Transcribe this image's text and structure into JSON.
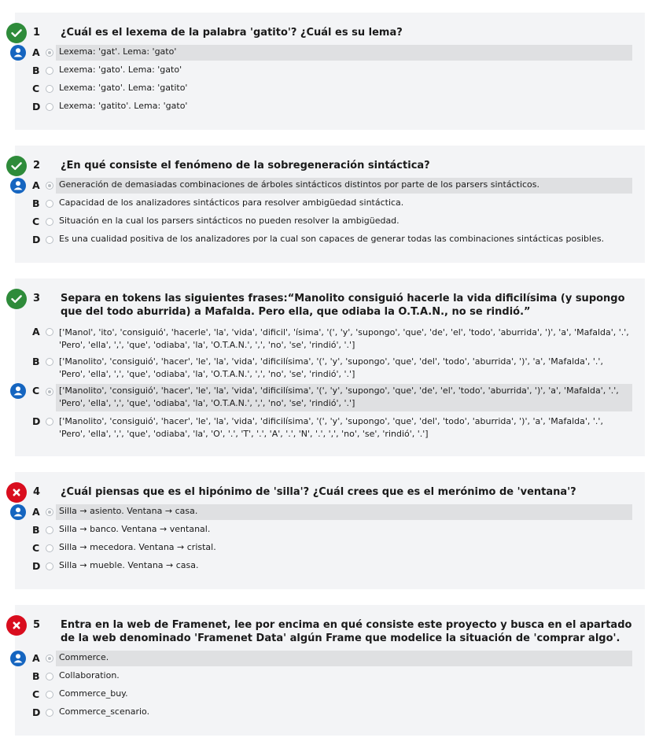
{
  "colors": {
    "correct": "#2e8b3a",
    "incorrect": "#d90d1e",
    "user": "#1565c0",
    "selected_bg": "#dfe0e2",
    "card_bg": "#f3f4f6"
  },
  "icons": {
    "correct": "check-circle-icon",
    "incorrect": "x-circle-icon",
    "user": "user-icon"
  },
  "questions": [
    {
      "number": "1",
      "status": "correct",
      "text": "¿Cuál es el lexema de la palabra 'gatito'? ¿Cuál es su lema?",
      "selected": 0,
      "options": [
        {
          "letter": "A",
          "text": "Lexema: 'gat'. Lema: 'gato'"
        },
        {
          "letter": "B",
          "text": "Lexema: 'gato'. Lema: 'gato'"
        },
        {
          "letter": "C",
          "text": "Lexema: 'gato'. Lema: 'gatito'"
        },
        {
          "letter": "D",
          "text": "Lexema: 'gatito'. Lema: 'gato'"
        }
      ]
    },
    {
      "number": "2",
      "status": "correct",
      "text": "¿En qué consiste el fenómeno de la sobregeneración sintáctica?",
      "selected": 0,
      "options": [
        {
          "letter": "A",
          "text": "Generación de demasiadas combinaciones de árboles sintácticos distintos por parte de los parsers sintácticos."
        },
        {
          "letter": "B",
          "text": "Capacidad de los analizadores sintácticos para resolver ambigüedad sintáctica."
        },
        {
          "letter": "C",
          "text": "Situación en la cual los parsers sintácticos no pueden resolver la ambigüedad."
        },
        {
          "letter": "D",
          "text": "Es una cualidad positiva de los analizadores por la cual son capaces de generar todas las combinaciones sintácticas posibles."
        }
      ]
    },
    {
      "number": "3",
      "status": "correct",
      "text": "Separa en tokens las siguientes frases:“Manolito consiguió hacerle la vida dificilísima (y supongo que del todo aburrida) a Mafalda. Pero ella, que odiaba la O.T.A.N., no se rindió.”",
      "selected": 2,
      "options": [
        {
          "letter": "A",
          "text": "['Manol', 'ito', 'consiguió', 'hacerle', 'la', 'vida', 'dificil', 'ísima', '(', 'y', 'supongo', 'que', 'de', 'el', 'todo', 'aburrida', ')', 'a', 'Mafalda', '.', 'Pero', 'ella', ',', 'que', 'odiaba', 'la', 'O.T.A.N.', ',', 'no', 'se', 'rindió', '.']"
        },
        {
          "letter": "B",
          "text": "['Manolito', 'consiguió', 'hacer', 'le', 'la', 'vida', 'dificilísima', '(', 'y', 'supongo', 'que', 'del', 'todo', 'aburrida', ')', 'a', 'Mafalda', '.', 'Pero', 'ella', ',', 'que', 'odiaba', 'la', 'O.T.A.N.', ',', 'no', 'se', 'rindió', '.']"
        },
        {
          "letter": "C",
          "text": "['Manolito', 'consiguió', 'hacer', 'le', 'la', 'vida', 'dificilísima', '(', 'y', 'supongo', 'que', 'de', 'el', 'todo', 'aburrida', ')', 'a', 'Mafalda', '.', 'Pero', 'ella', ',', 'que', 'odiaba', 'la', 'O.T.A.N.', ',', 'no', 'se', 'rindió', '.']"
        },
        {
          "letter": "D",
          "text": "['Manolito', 'consiguió', 'hacer', 'le', 'la', 'vida', 'dificilísima', '(', 'y', 'supongo', 'que', 'del', 'todo', 'aburrida', ')', 'a', 'Mafalda', '.', 'Pero', 'ella', ',', 'que', 'odiaba', 'la', 'O', '.', 'T', '.', 'A', '.', 'N', '.', ',', 'no', 'se', 'rindió', '.']"
        }
      ]
    },
    {
      "number": "4",
      "status": "incorrect",
      "text": "¿Cuál piensas que es el hipónimo de 'silla'? ¿Cuál crees que es el merónimo de 'ventana'?",
      "selected": 0,
      "options": [
        {
          "letter": "A",
          "text": "Silla → asiento. Ventana → casa."
        },
        {
          "letter": "B",
          "text": "Silla → banco. Ventana → ventanal."
        },
        {
          "letter": "C",
          "text": "Silla → mecedora. Ventana → cristal."
        },
        {
          "letter": "D",
          "text": "Silla → mueble. Ventana → casa."
        }
      ]
    },
    {
      "number": "5",
      "status": "incorrect",
      "text": "Entra en la web de Framenet, lee por encima en qué consiste este proyecto y busca en el apartado de la web denominado 'Framenet Data' algún Frame que modelice la situación de 'comprar algo'.",
      "selected": 0,
      "options": [
        {
          "letter": "A",
          "text": "Commerce."
        },
        {
          "letter": "B",
          "text": "Collaboration."
        },
        {
          "letter": "C",
          "text": "Commerce_buy."
        },
        {
          "letter": "D",
          "text": "Commerce_scenario."
        }
      ]
    }
  ]
}
